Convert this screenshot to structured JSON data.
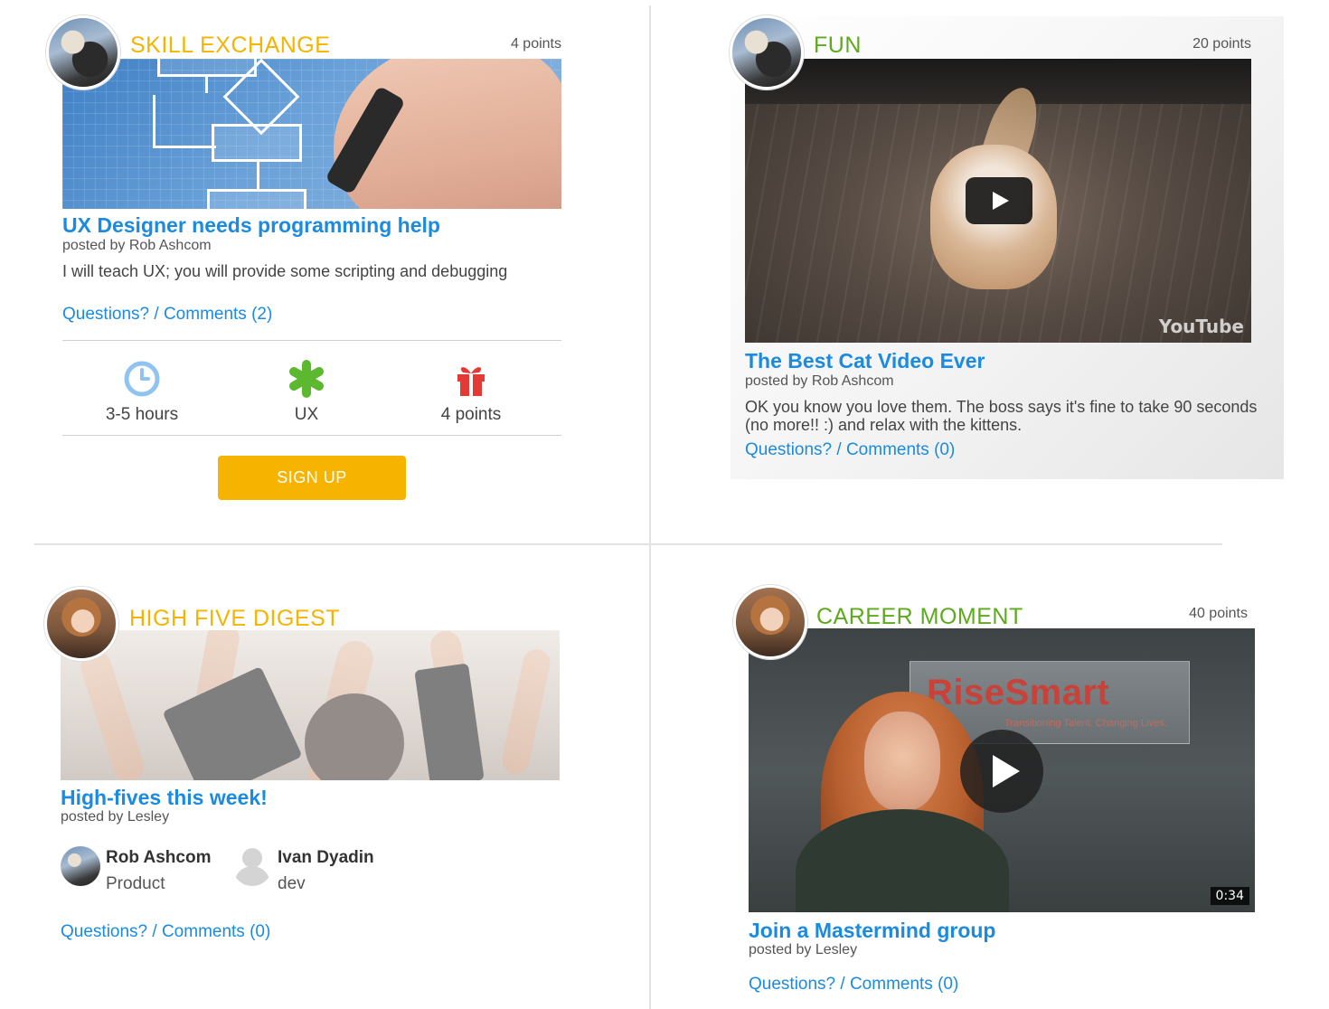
{
  "cards": {
    "skill": {
      "category": "SKILL EXCHANGE",
      "points": "4 points",
      "title": "UX Designer needs programming help",
      "posted": "posted by Rob Ashcom",
      "description": "I will teach UX; you will provide some scripting and debugging",
      "comments": "Questions? / Comments (2)",
      "stats": [
        {
          "icon": "clock-icon",
          "label": "3-5 hours"
        },
        {
          "icon": "asterisk-icon",
          "label": "UX"
        },
        {
          "icon": "gift-icon",
          "label": "4 points"
        }
      ],
      "signup_label": "SIGN UP"
    },
    "fun": {
      "category": "FUN",
      "points": "20 points",
      "title": "The Best Cat Video Ever",
      "posted": "posted by Rob Ashcom",
      "description": "OK you know you love them. The boss says it's fine to take 90 seconds (no more!! :) and relax with the kittens.",
      "comments": "Questions? / Comments (0)",
      "video_brand": "YouTube"
    },
    "highfive": {
      "category": "HIGH FIVE DIGEST",
      "title": "High-fives this week!",
      "posted": "posted by Lesley",
      "people": [
        {
          "name": "Rob Ashcom",
          "role": "Product"
        },
        {
          "name": "Ivan Dyadin",
          "role": "dev"
        }
      ],
      "comments": "Questions? / Comments (0)"
    },
    "career": {
      "category": "CAREER MOMENT",
      "points": "40 points",
      "title": "Join a Mastermind group",
      "posted": "posted by Lesley",
      "comments": "Questions? / Comments (0)",
      "video_logo_prefix": "Rise",
      "video_logo_suffix": "Smart",
      "video_tagline": "Transitioning Talent. Changing Lives.",
      "duration": "0:34"
    }
  },
  "colors": {
    "accent_blue": "#1a8be0",
    "orange": "#f5b400",
    "green": "#5eaa1e",
    "signup": "#f6b300",
    "gift_red": "#e53935",
    "asterisk_green": "#5cb82e",
    "clock_blue": "#8ec3f2"
  }
}
